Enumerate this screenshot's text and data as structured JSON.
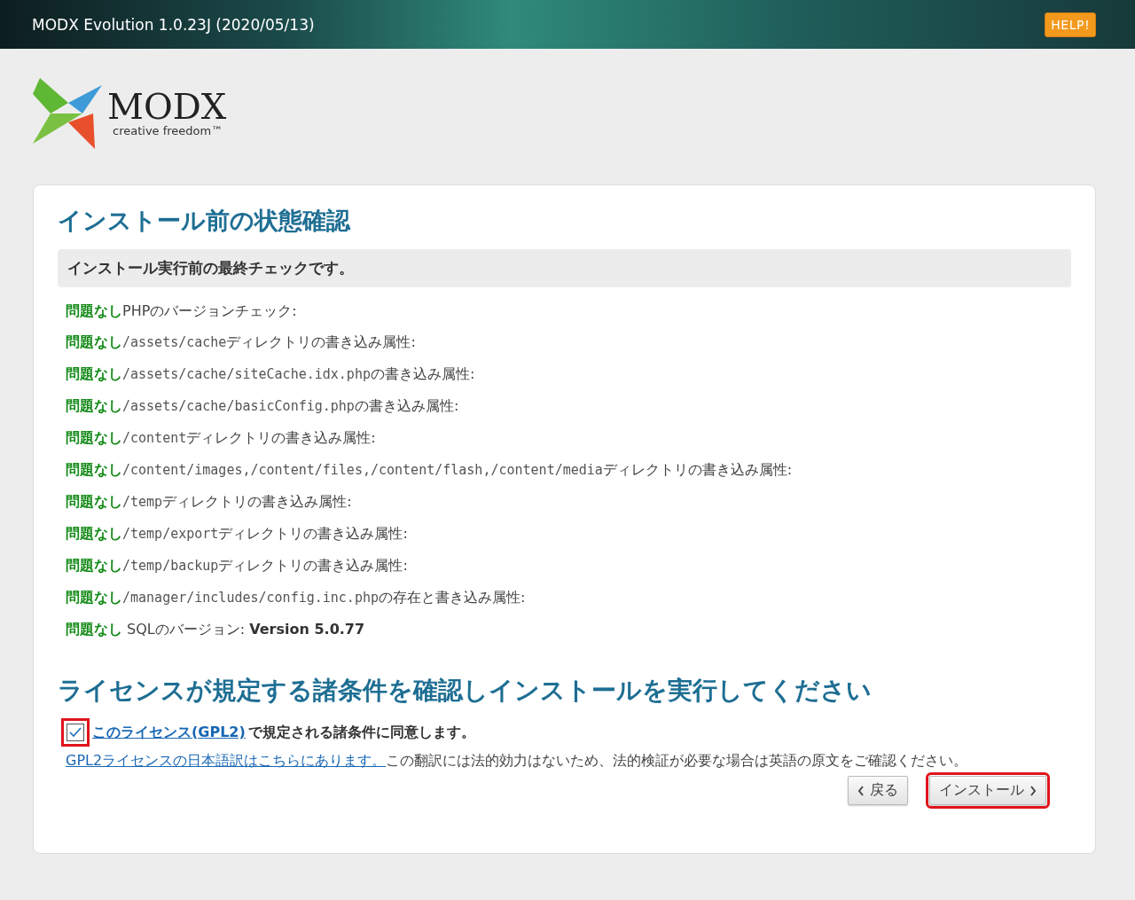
{
  "header": {
    "title": "MODX Evolution 1.0.23J (2020/05/13)",
    "help_button": "HELP!"
  },
  "logo": {
    "wordmark": "MODX",
    "tagline": "creative freedom™"
  },
  "card": {
    "title": "インストール前の状態確認",
    "notice": "インストール実行前の最終チェックです。",
    "checks": [
      {
        "status": "問題なし",
        "text": "PHPのバージョンチェック:"
      },
      {
        "status": "問題なし",
        "path": "/assets/cache",
        "text": "ディレクトリの書き込み属性:"
      },
      {
        "status": "問題なし",
        "path": "/assets/cache/siteCache.idx.php",
        "text": "の書き込み属性:"
      },
      {
        "status": "問題なし",
        "path": "/assets/cache/basicConfig.php",
        "text": "の書き込み属性:"
      },
      {
        "status": "問題なし",
        "path": "/content",
        "text": "ディレクトリの書き込み属性:"
      },
      {
        "status": "問題なし",
        "path": "/content/images,/content/files,/content/flash,/content/media",
        "text": "ディレクトリの書き込み属性:"
      },
      {
        "status": "問題なし",
        "path": "/temp",
        "text": "ディレクトリの書き込み属性:"
      },
      {
        "status": "問題なし",
        "path": "/temp/export",
        "text": "ディレクトリの書き込み属性:"
      },
      {
        "status": "問題なし",
        "path": "/temp/backup",
        "text": "ディレクトリの書き込み属性:"
      },
      {
        "status": "問題なし",
        "path": "/manager/includes/config.inc.php",
        "text": "の存在と書き込み属性:"
      },
      {
        "status": "問題なし",
        "text": " SQLのバージョン: ",
        "value": "Version 5.0.77"
      }
    ],
    "license_title": "ライセンスが規定する諸条件を確認しインストールを実行してください",
    "agree": {
      "checked": true,
      "highlighted": true,
      "link": "このライセンス(GPL2)",
      "text": "で規定される諸条件に同意します。"
    },
    "translation": {
      "link": "GPL2ライセンスの日本語訳はこちらにあります。",
      "text": "この翻訳には法的効力はないため、法的検証が必要な場合は英語の原文をご確認ください。"
    },
    "buttons": [
      {
        "kind": "back",
        "label": "戻る",
        "highlighted": false
      },
      {
        "kind": "next",
        "label": "インストール",
        "highlighted": true
      }
    ]
  }
}
